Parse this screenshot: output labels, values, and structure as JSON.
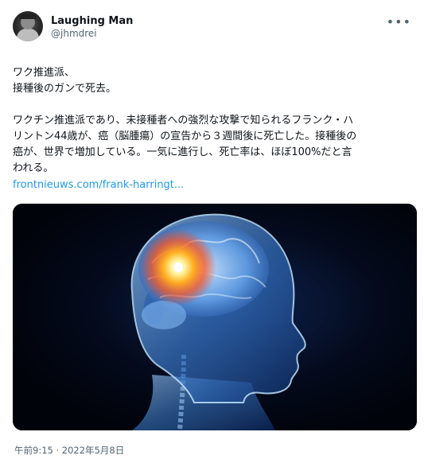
{
  "author": {
    "display_name": "Laughing Man",
    "handle": "@jhmdrei"
  },
  "tweet": {
    "lines": [
      "ワク推進派、",
      "接種後のガンで死去。",
      "",
      "ワクチン推進派であり、未接種者への強烈な攻撃で知られるフランク・ハ",
      "リントン44歳が、癌（脳腫瘍）の宣告から３週間後に死亡した。接種後の",
      "癌が、世界で増加している。一気に進行し、死亡率は、ほぼ100%だと言",
      "われる。"
    ],
    "link_text": "frontnieuws.com/frank-harringt..."
  },
  "timestamp": "午前9:15 · 2022年5月8日",
  "icons": {
    "more": "more-options-icon"
  },
  "colors": {
    "link": "#1d9bf0",
    "secondary_text": "#536471",
    "media_bg": "#02050e",
    "glow": "#ff6a1a"
  }
}
